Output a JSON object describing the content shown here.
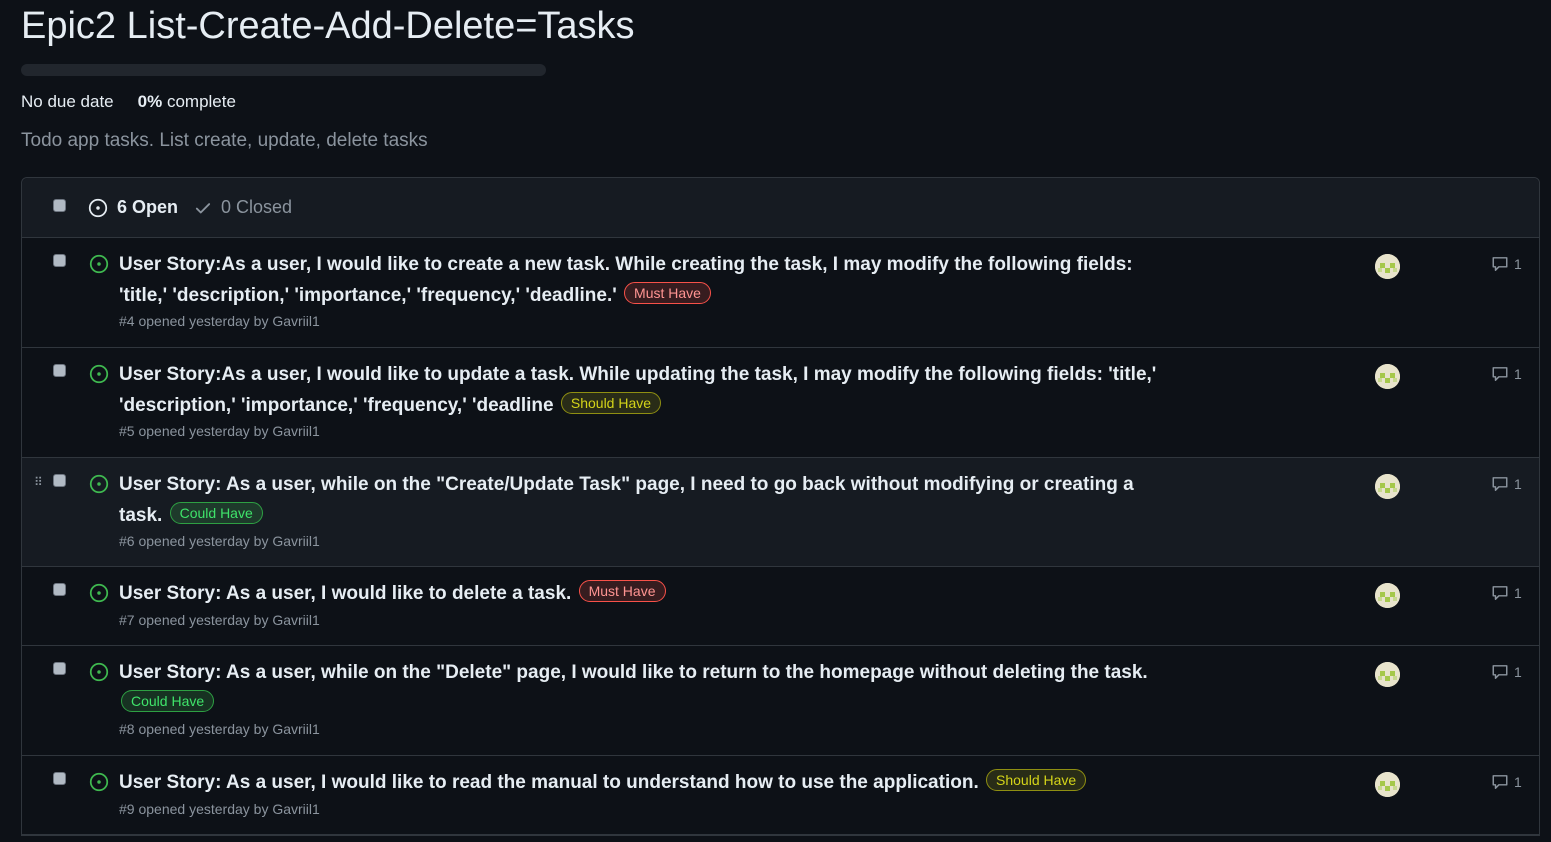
{
  "milestone": {
    "title": "Epic2 List-Create-Add-Delete=Tasks",
    "progress_fraction": 0,
    "due": "No due date",
    "percent": "0%",
    "complete_label": "complete",
    "description": "Todo app tasks. List create, update, delete tasks"
  },
  "header": {
    "open_label": "6 Open",
    "closed_label": "0 Closed"
  },
  "colors": {
    "open_icon": "#3fb950",
    "must_have": "#f85149",
    "should_have": "#d4d419",
    "could_have": "#3fb950"
  },
  "issues": [
    {
      "title": "User Story:As a user, I would like to create a new task. While creating the task, I may modify the following fields: 'title,' 'description,' 'importance,' 'frequency,' 'deadline.'",
      "label": "Must Have",
      "meta": "#4 opened yesterday by Gavriil1",
      "comments": "1"
    },
    {
      "title": "User Story:As a user, I would like to update a task. While updating the task, I may modify the following fields: 'title,' 'description,' 'importance,' 'frequency,' 'deadline",
      "label": "Should Have",
      "meta": "#5 opened yesterday by Gavriil1",
      "comments": "1"
    },
    {
      "title": "User Story: As a user, while on the \"Create/Update Task\" page, I need to go back without modifying or creating a task.",
      "label": "Could Have",
      "meta": "#6 opened yesterday by Gavriil1",
      "comments": "1"
    },
    {
      "title": "User Story: As a user, I would like to delete a task.",
      "label": "Must Have",
      "meta": "#7 opened yesterday by Gavriil1",
      "comments": "1"
    },
    {
      "title": "User Story: As a user, while on the \"Delete\" page, I would like to return to the homepage without deleting the task.",
      "label": "Could Have",
      "meta": "#8 opened yesterday by Gavriil1",
      "comments": "1"
    },
    {
      "title": "User Story: As a user, I would like to read the manual to understand how to use the application.",
      "label": "Should Have",
      "meta": "#9 opened yesterday by Gavriil1",
      "comments": "1"
    }
  ]
}
